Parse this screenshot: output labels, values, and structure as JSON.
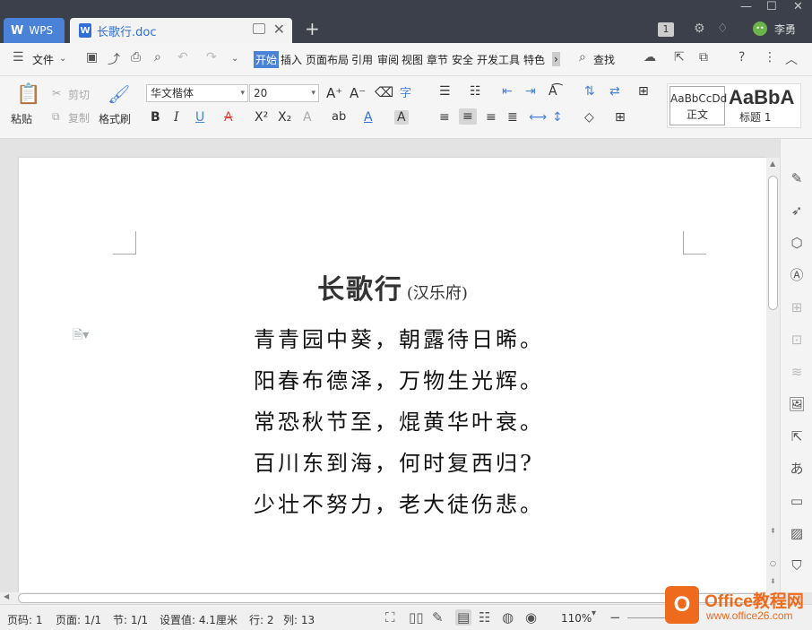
{
  "titlebar": {
    "app_tab": "WPS",
    "doc_tab": "长歌行.doc",
    "doc_icon": "W",
    "new_tab": "+",
    "badge": "1",
    "user_name": "李勇",
    "avatar_text": "••"
  },
  "menubar": {
    "file": "文件",
    "tabs": [
      "开始",
      "插入",
      "页面布局",
      "引用",
      "审阅",
      "视图",
      "章节",
      "安全",
      "开发工具",
      "特色"
    ],
    "more": "›",
    "search": "查找"
  },
  "ribbon": {
    "paste": "粘贴",
    "cut": "剪切",
    "copy": "复制",
    "format_painter": "格式刷",
    "font_name": "华文楷体",
    "font_size": "20",
    "style_normal_sample": "AaBbCcDd",
    "style_normal_name": "正文",
    "style_h1_sample": "AaBbA",
    "style_h1_name": "标题 1"
  },
  "document": {
    "title": "长歌行",
    "subtitle": "(汉乐府)",
    "lines": [
      "青青园中葵，朝露待日晞。",
      "阳春布德泽，万物生光辉。",
      "常恐秋节至，焜黄华叶衰。",
      "百川东到海，何时复西归?",
      "少壮不努力，老大徒伤悲。"
    ]
  },
  "statusbar": {
    "page_num": "页码: 1",
    "pages": "页面: 1/1",
    "section": "节: 1/1",
    "setting": "设置值: 4.1厘米",
    "row": "行: 2",
    "col": "列: 13",
    "zoom": "110%"
  },
  "watermark": {
    "logo": "O",
    "brand": "Office教程网",
    "url": "www.office26.com"
  },
  "colors": {
    "accent": "#4a82d8",
    "titlebar": "#3b404b",
    "watermark": "#ee6a1c"
  }
}
